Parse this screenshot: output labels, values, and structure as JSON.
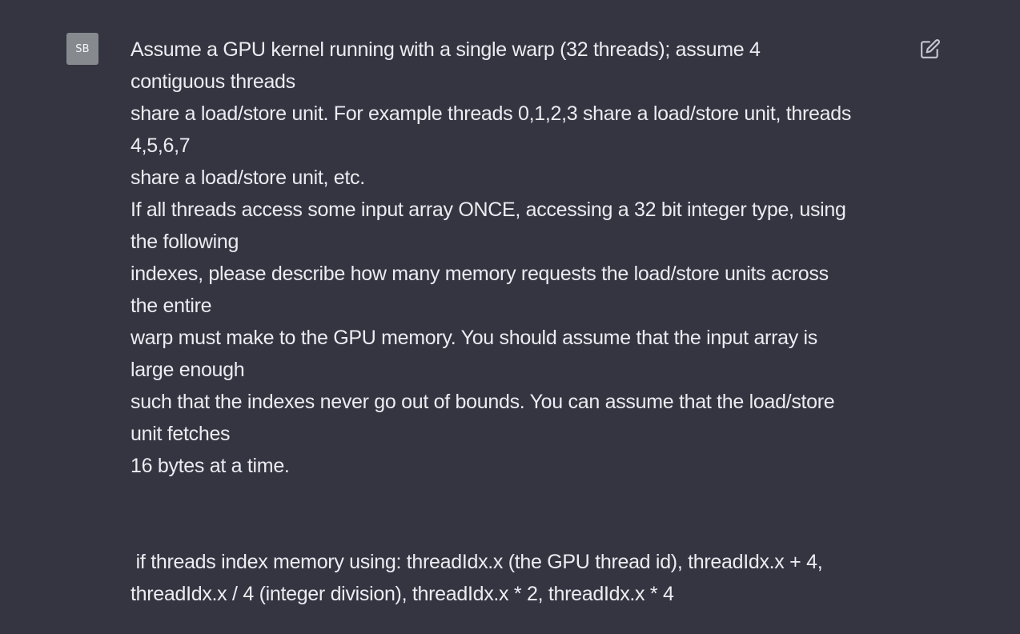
{
  "user": {
    "avatar_initials": "SB"
  },
  "message": {
    "lines": [
      "Assume a GPU kernel running with a single warp (32 threads); assume 4",
      "contiguous threads",
      "share a load/store unit. For example threads 0,1,2,3 share a load/store unit, threads",
      "4,5,6,7",
      "share a load/store unit, etc.",
      "If all threads access some input array ONCE, accessing a 32 bit integer type, using",
      "the following",
      "indexes, please describe how many memory requests the load/store units across",
      "the entire",
      "warp must make to the GPU memory. You should assume that the input array is",
      "large enough",
      "such that the indexes never go out of bounds. You can assume that the load/store",
      "unit fetches",
      "16 bytes at a time.",
      "",
      "",
      " if threads index memory using: threadIdx.x (the GPU thread id), threadIdx.x + 4,",
      "threadIdx.x / 4 (integer division), threadIdx.x * 2, threadIdx.x * 4"
    ]
  },
  "icons": {
    "edit": "edit-icon"
  },
  "colors": {
    "background": "#343541",
    "text": "#ececf1",
    "avatar_bg": "#868a8f",
    "icon": "#c5c5d2"
  }
}
